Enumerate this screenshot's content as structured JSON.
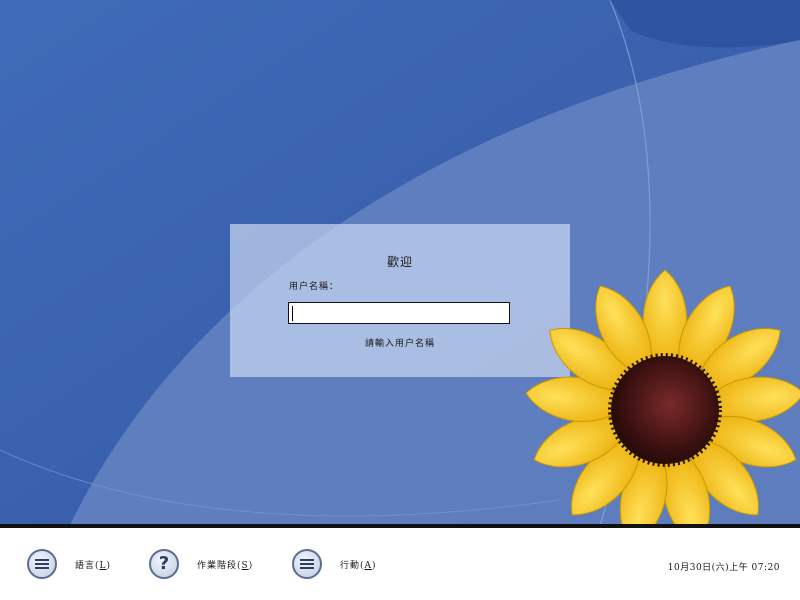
{
  "login": {
    "welcome_title": "歡迎",
    "username_label": "用户名稱：",
    "username_value": "",
    "hint_text": "請輸入用户名稱"
  },
  "bottom_bar": {
    "language": {
      "label": "語言(",
      "mnemonic": "L",
      "suffix": ")",
      "icon": "menu-lines-icon"
    },
    "session": {
      "label": "作業階段(",
      "mnemonic": "S",
      "suffix": ")",
      "icon": "question-mark-icon"
    },
    "actions": {
      "label": "行動(",
      "mnemonic": "A",
      "suffix": ")",
      "icon": "menu-lines-icon"
    },
    "clock": "10月30日(六)上午 07:20"
  },
  "colors": {
    "wallpaper_dark": "#3a62b0",
    "wallpaper_light": "#6f8fcb",
    "flower_petal": "#f5c518",
    "flower_center": "#3b1010"
  }
}
